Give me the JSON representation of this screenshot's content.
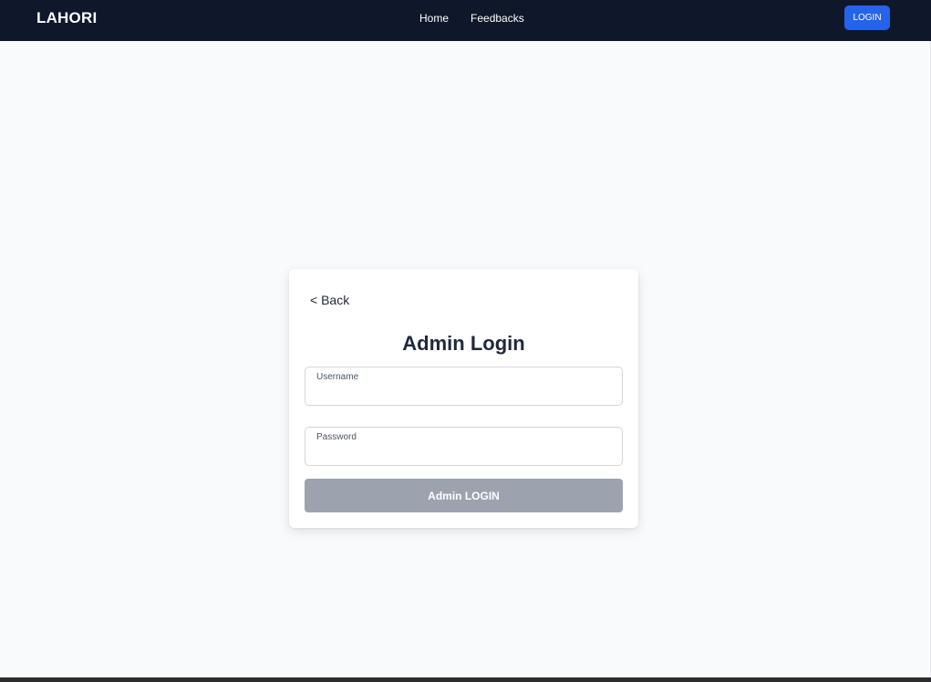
{
  "header": {
    "brand": "LAHORI",
    "nav": [
      {
        "label": "Home"
      },
      {
        "label": "Feedbacks"
      }
    ],
    "login_label": "LOGIN"
  },
  "login_card": {
    "back_label": "< Back",
    "title": "Admin Login",
    "username_label": "Username",
    "username_value": "",
    "password_label": "Password",
    "password_value": "",
    "submit_label": "Admin LOGIN",
    "submit_state": "disabled"
  },
  "colors": {
    "header_bg": "#0f172a",
    "page_bg": "#f8fafc",
    "accent": "#2563eb",
    "disabled_button": "#9ca3af"
  }
}
